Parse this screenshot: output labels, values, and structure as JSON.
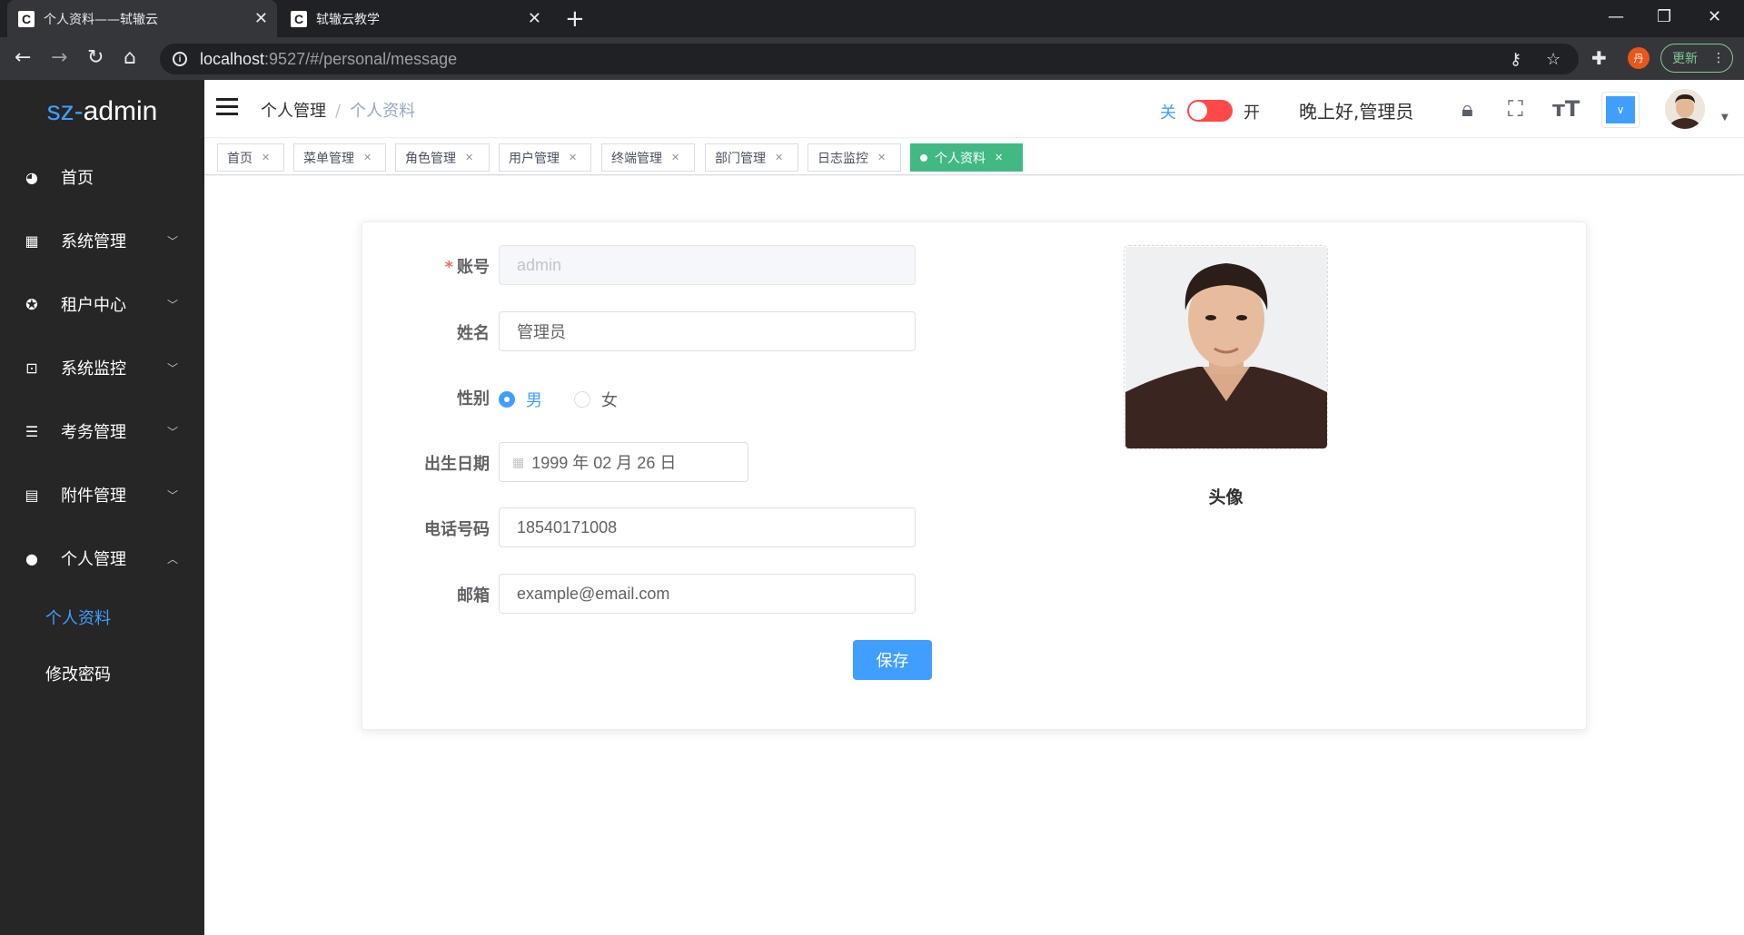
{
  "browser": {
    "tabs": [
      {
        "title": "个人资料——轼辙云",
        "active": true
      },
      {
        "title": "轼辙云教学",
        "active": false
      }
    ],
    "url_host": "localhost",
    "url_path": ":9527/#/personal/message",
    "update_label": "更新",
    "profile_initial": "丹"
  },
  "sidebar": {
    "logo_prefix": "sz-",
    "logo_suffix": "admin",
    "items": [
      {
        "label": "首页",
        "icon": "dashboard-icon"
      },
      {
        "label": "系统管理",
        "icon": "grid-icon"
      },
      {
        "label": "租户中心",
        "icon": "tenant-icon"
      },
      {
        "label": "系统监控",
        "icon": "monitor-icon"
      },
      {
        "label": "考务管理",
        "icon": "list-icon"
      },
      {
        "label": "附件管理",
        "icon": "document-icon"
      },
      {
        "label": "个人管理",
        "icon": "user-icon"
      }
    ],
    "sub_items": [
      {
        "label": "个人资料",
        "active": true
      },
      {
        "label": "修改密码",
        "active": false
      }
    ]
  },
  "header": {
    "breadcrumb": [
      "个人管理",
      "个人资料"
    ],
    "breadcrumb_sep": "/",
    "switch_off_label": "关",
    "switch_on_label": "开",
    "greeting": "晚上好,管理员",
    "accent_color": "#409eff"
  },
  "tags": [
    {
      "label": "首页",
      "active": false
    },
    {
      "label": "菜单管理",
      "active": false
    },
    {
      "label": "角色管理",
      "active": false
    },
    {
      "label": "用户管理",
      "active": false
    },
    {
      "label": "终端管理",
      "active": false
    },
    {
      "label": "部门管理",
      "active": false
    },
    {
      "label": "日志监控",
      "active": false
    },
    {
      "label": "个人资料",
      "active": true
    }
  ],
  "form": {
    "account_label": "账号",
    "account_required": "*",
    "account_value": "admin",
    "name_label": "姓名",
    "name_value": "管理员",
    "gender_label": "性别",
    "gender_options": [
      "男",
      "女"
    ],
    "gender_selected": "男",
    "birth_label": "出生日期",
    "birth_value": "1999 年 02 月 26 日",
    "phone_label": "电话号码",
    "phone_value": "18540171008",
    "email_label": "邮箱",
    "email_value": "example@email.com",
    "save_label": "保存",
    "avatar_label": "头像"
  }
}
